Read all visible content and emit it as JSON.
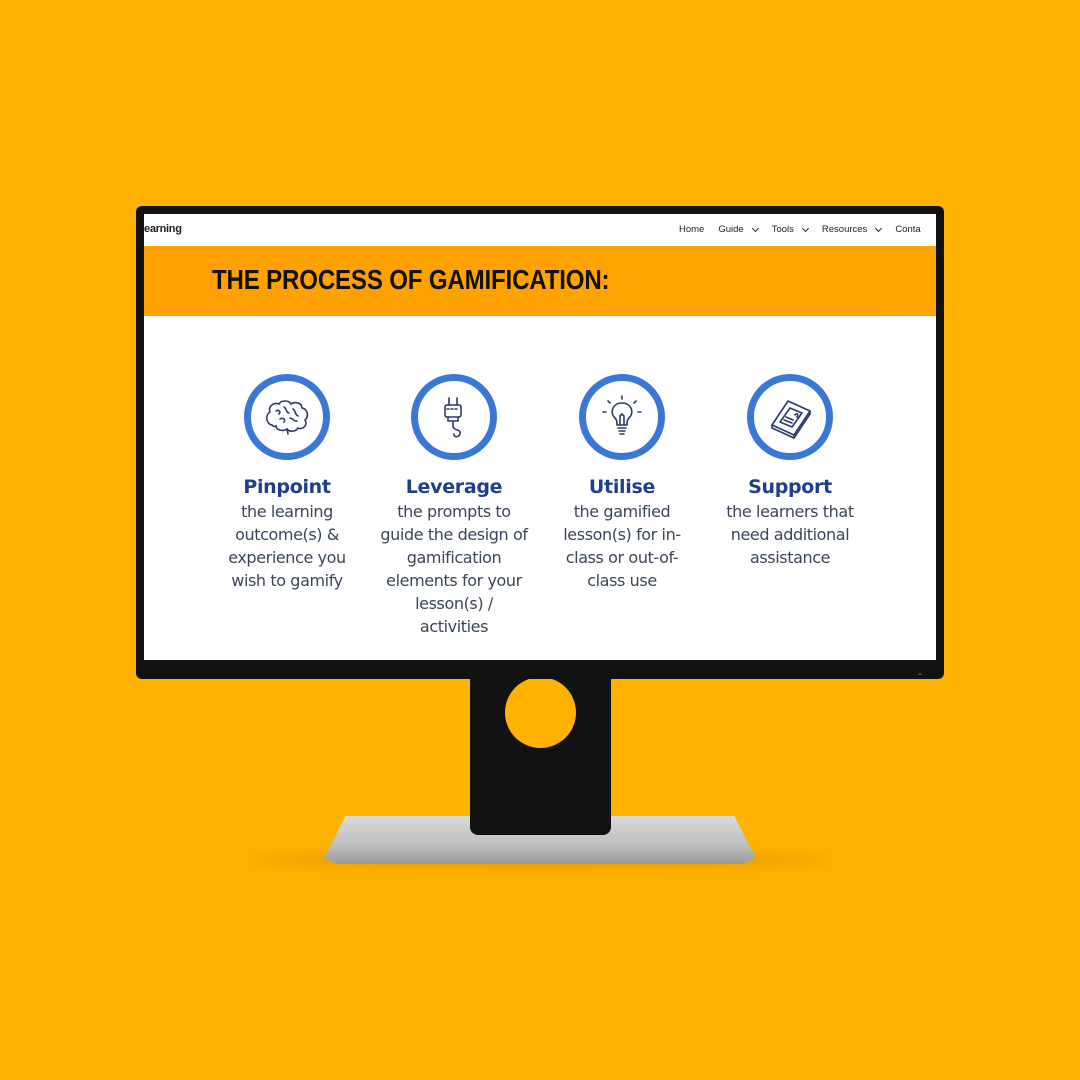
{
  "site": {
    "logo_text": "earning"
  },
  "nav": {
    "items": [
      {
        "label": "Home",
        "has_dropdown": false
      },
      {
        "label": "Guide",
        "has_dropdown": true
      },
      {
        "label": "Tools",
        "has_dropdown": true
      },
      {
        "label": "Resources",
        "has_dropdown": true
      },
      {
        "label": "Conta",
        "has_dropdown": false
      }
    ]
  },
  "banner": {
    "title": "THE PROCESS OF GAMIFICATION:"
  },
  "steps": [
    {
      "icon": "brain-icon",
      "title": "Pinpoint",
      "lines": [
        "the learning",
        "outcome(s) &",
        "experience you",
        "wish to gamify"
      ]
    },
    {
      "icon": "plug-icon",
      "title": "Leverage",
      "lines": [
        "the prompts to",
        "guide the design of",
        "gamification",
        "elements for your",
        "lesson(s) /",
        "activities"
      ]
    },
    {
      "icon": "lightbulb-icon",
      "title": "Utilise",
      "lines": [
        "the gamified",
        "lesson(s) for in-",
        "class or out-of-",
        "class use"
      ]
    },
    {
      "icon": "book-icon",
      "title": "Support",
      "lines": [
        "the learners that",
        "need additional",
        "assistance"
      ]
    }
  ],
  "colors": {
    "background": "#FFB300",
    "banner": "#FFA000",
    "circle": "#3A78D8",
    "step_title": "#1E3F8C",
    "step_text": "#3A4657"
  }
}
